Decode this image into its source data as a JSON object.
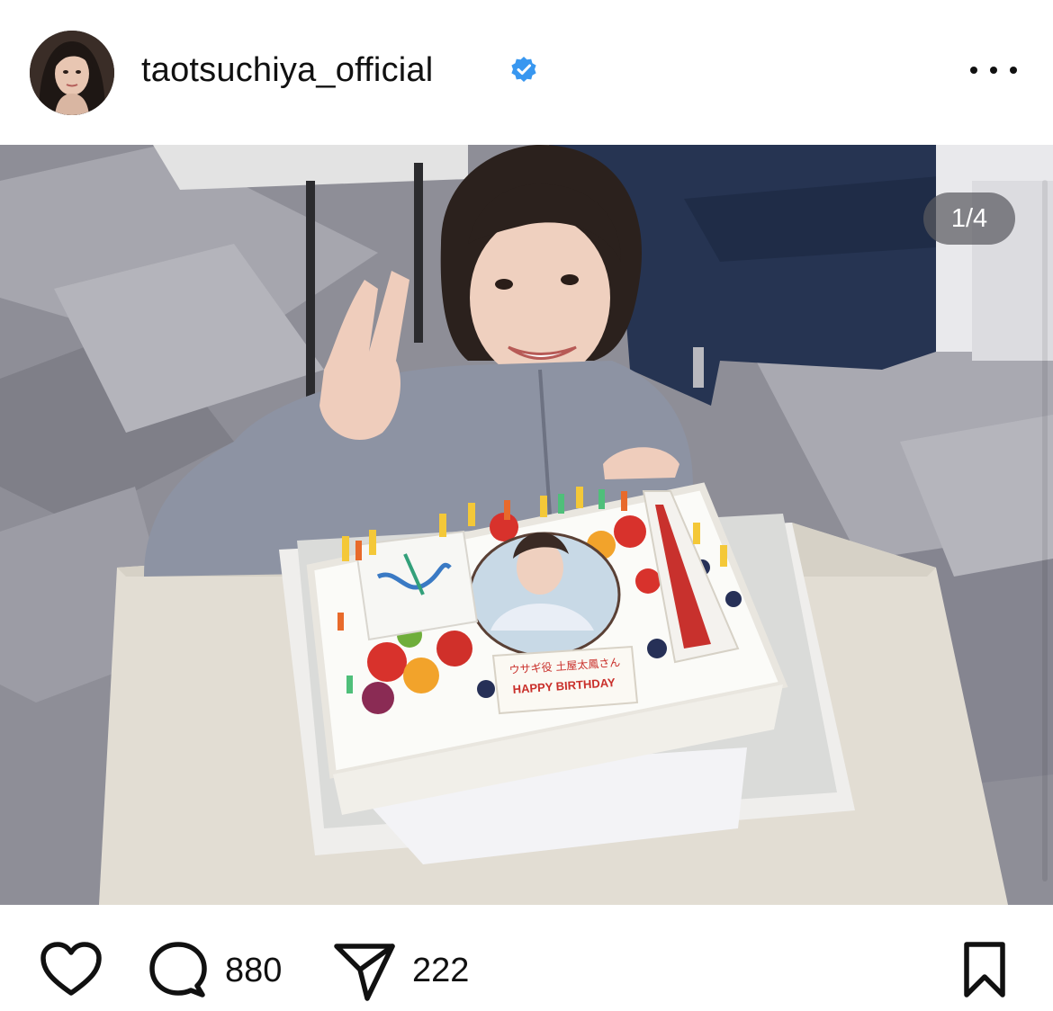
{
  "post": {
    "username": "taotsuchiya_official",
    "verified": true,
    "avatar_icon": "profile-photo",
    "more_icon": "more-horizontal-icon",
    "media_counter": "1/4",
    "carousel": {
      "count": 4,
      "active": 1
    },
    "photo_description_icon": "birthday-cake-photo",
    "cake_plaque": {
      "name_line": "ウサギ役 土屋太鳳さん",
      "greeting": "HAPPY BIRTHDAY"
    }
  },
  "actions": {
    "like_icon": "heart-icon",
    "comment_icon": "comment-icon",
    "comment_count": "880",
    "share_icon": "send-icon",
    "share_count": "222",
    "save_icon": "bookmark-icon"
  },
  "colors": {
    "verified_badge": "#3897f0",
    "text": "#111111",
    "background": "#ffffff"
  }
}
